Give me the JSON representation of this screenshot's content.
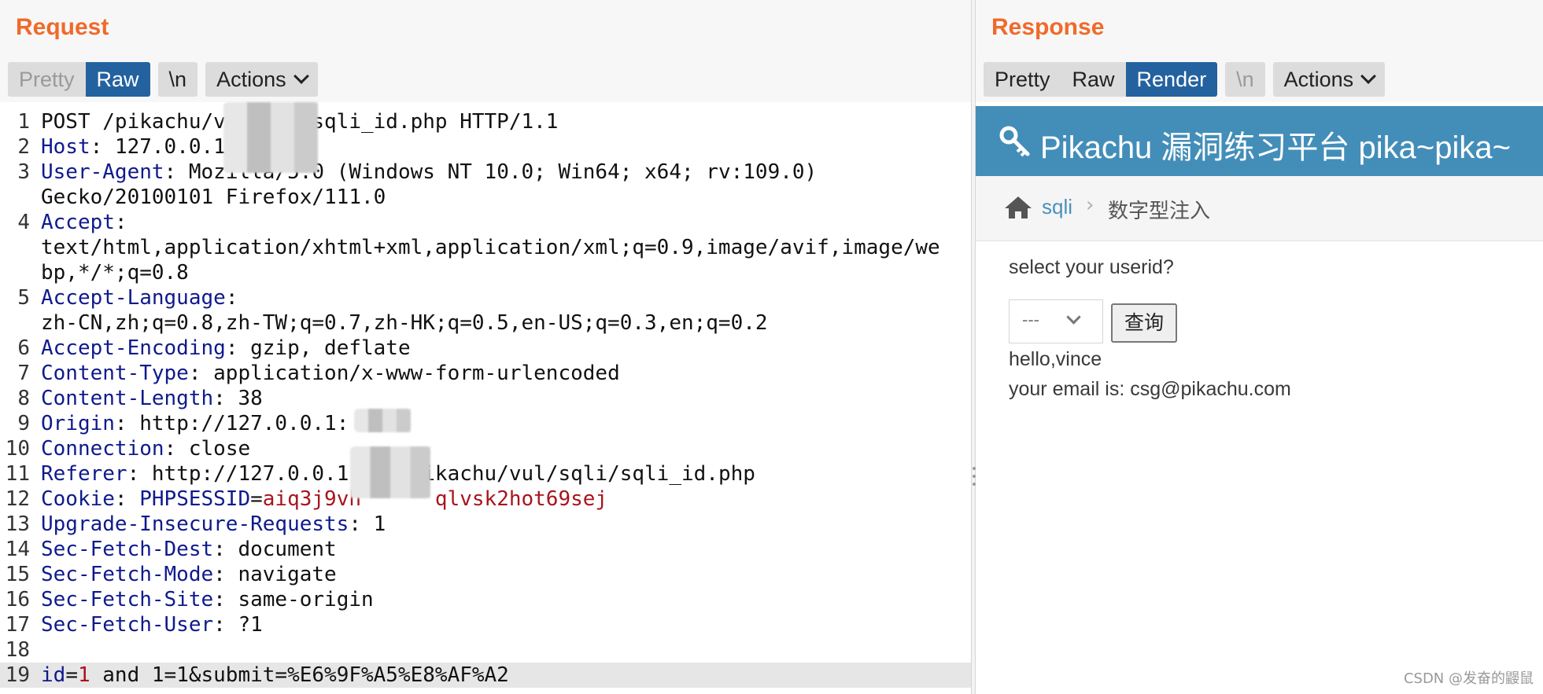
{
  "request": {
    "title": "Request",
    "tabs": [
      "Pretty",
      "Raw",
      "\\n",
      "Actions"
    ],
    "lines": [
      {
        "n": "1",
        "name": "",
        "sep": "",
        "value": "POST /pikachu/v      /sqli_id.php HTTP/1.1"
      },
      {
        "n": "2",
        "name": "Host",
        "sep": ": ",
        "value": "127.0.0.1"
      },
      {
        "n": "3",
        "name": "User-Agent",
        "sep": ": ",
        "value": "Mozilla/5.0 (Windows NT 10.0; Win64; x64; rv:109.0)"
      },
      {
        "n": "",
        "name": "",
        "sep": "",
        "value": "Gecko/20100101 Firefox/111.0"
      },
      {
        "n": "4",
        "name": "Accept",
        "sep": ":",
        "value": ""
      },
      {
        "n": "",
        "name": "",
        "sep": "",
        "value": "text/html,application/xhtml+xml,application/xml;q=0.9,image/avif,image/we"
      },
      {
        "n": "",
        "name": "",
        "sep": "",
        "value": "bp,*/*;q=0.8"
      },
      {
        "n": "5",
        "name": "Accept-Language",
        "sep": ":",
        "value": ""
      },
      {
        "n": "",
        "name": "",
        "sep": "",
        "value": "zh-CN,zh;q=0.8,zh-TW;q=0.7,zh-HK;q=0.5,en-US;q=0.3,en;q=0.2"
      },
      {
        "n": "6",
        "name": "Accept-Encoding",
        "sep": ": ",
        "value": "gzip, deflate"
      },
      {
        "n": "7",
        "name": "Content-Type",
        "sep": ": ",
        "value": "application/x-www-form-urlencoded"
      },
      {
        "n": "8",
        "name": "Content-Length",
        "sep": ": ",
        "value": "38"
      },
      {
        "n": "9",
        "name": "Origin",
        "sep": ": ",
        "value": "http://127.0.0.1:"
      },
      {
        "n": "10",
        "name": "Connection",
        "sep": ": ",
        "value": "close"
      },
      {
        "n": "11",
        "name": "Referer",
        "sep": ": ",
        "value": "http://127.0.0.1     pikachu/vul/sqli/sqli_id.php"
      },
      {
        "n": "12",
        "name": "Cookie",
        "sep": ": ",
        "value": "",
        "cookie_name": "PHPSESSID",
        "cookie_eq": "=",
        "cookie_value": "aiq3j9vh      qlvsk2hot69sej"
      },
      {
        "n": "13",
        "name": "Upgrade-Insecure-Requests",
        "sep": ": ",
        "value": "1"
      },
      {
        "n": "14",
        "name": "Sec-Fetch-Dest",
        "sep": ": ",
        "value": "document"
      },
      {
        "n": "15",
        "name": "Sec-Fetch-Mode",
        "sep": ": ",
        "value": "navigate"
      },
      {
        "n": "16",
        "name": "Sec-Fetch-Site",
        "sep": ": ",
        "value": "same-origin"
      },
      {
        "n": "17",
        "name": "Sec-Fetch-User",
        "sep": ": ",
        "value": "?1"
      },
      {
        "n": "18",
        "name": "",
        "sep": "",
        "value": ""
      },
      {
        "n": "19",
        "name": "id",
        "sep": "=",
        "value": " and 1=1&submit=%E6%9F%A5%E8%AF%A2",
        "param_value": "1"
      }
    ]
  },
  "response": {
    "title": "Response",
    "tabs": [
      "Pretty",
      "Raw",
      "Render",
      "\\n",
      "Actions"
    ],
    "render": {
      "site_title": "Pikachu 漏洞练习平台 pika~pika~",
      "breadcrumb_link": "sqli",
      "breadcrumb_sep": "›",
      "breadcrumb_current": "数字型注入",
      "form_label": "select your userid?",
      "select_value": "---",
      "query_button": "查询",
      "result_line1": "hello,vince",
      "result_line2": "your email is: csg@pikachu.com"
    },
    "watermark": "CSDN @发奋的鼹鼠"
  },
  "colors": {
    "title_orange": "#f06a2a",
    "tab_active": "#23629f",
    "header_name": "#0f1a8c",
    "cookie_value": "#a8141e",
    "render_header": "#438eb9"
  }
}
